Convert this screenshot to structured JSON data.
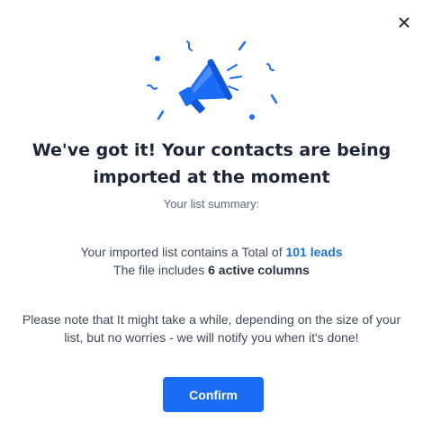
{
  "dialog": {
    "title": "We've got it! Your contacts are being imported at the moment",
    "subtitle": "Your list summary:",
    "summary": {
      "line1_prefix": "Your imported list contains a Total of",
      "leads_count": "101 leads",
      "line2_prefix": "The file includes",
      "columns_count": "6 active columns"
    },
    "note": "Please note that It might take a while, depending on the size of your list, but no worries - we will notify you when it's done!",
    "confirm_label": "Confirm",
    "close_icon": "close-icon",
    "illustration_icon": "megaphone-icon"
  },
  "colors": {
    "accent": "#1a6cf5",
    "highlight_text": "#1f6fe0",
    "title_text": "#1d2638",
    "body_text": "#3f4a5c"
  }
}
